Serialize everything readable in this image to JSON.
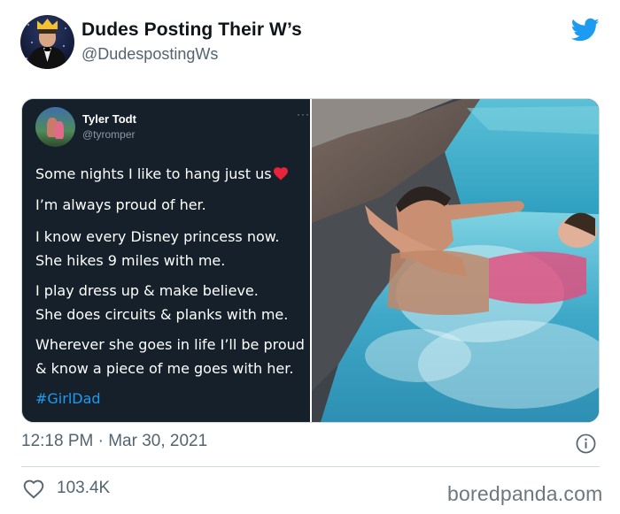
{
  "tweet": {
    "display_name": "Dudes Posting Their W’s",
    "handle": "@DudespostingWs",
    "timestamp": "12:18 PM · Mar 30, 2021",
    "likes": "103.4K"
  },
  "embedded_tweet": {
    "name": "Tyler Todt",
    "handle": "@tyromper",
    "menu": "···",
    "lines": [
      "Some nights I like to hang just us",
      "I’m always proud of her.",
      "I know every Disney princess now.",
      "She hikes 9 miles with me.",
      "I play dress up & make believe.",
      "She does circuits & planks with me.",
      "Wherever she goes in life I’ll be proud",
      "& know a piece of me goes with her."
    ],
    "hashtag": "#GirlDad"
  },
  "icons": {
    "logo": "twitter-bird-icon",
    "info": "info-icon",
    "like": "heart-icon",
    "emoji": "red-heart-icon"
  },
  "colors": {
    "twitter_blue": "#1d9bf0",
    "dark_card": "#15202b",
    "muted_text": "#536471",
    "emoji_red": "#e8233a"
  },
  "watermark": "boredpanda.com"
}
